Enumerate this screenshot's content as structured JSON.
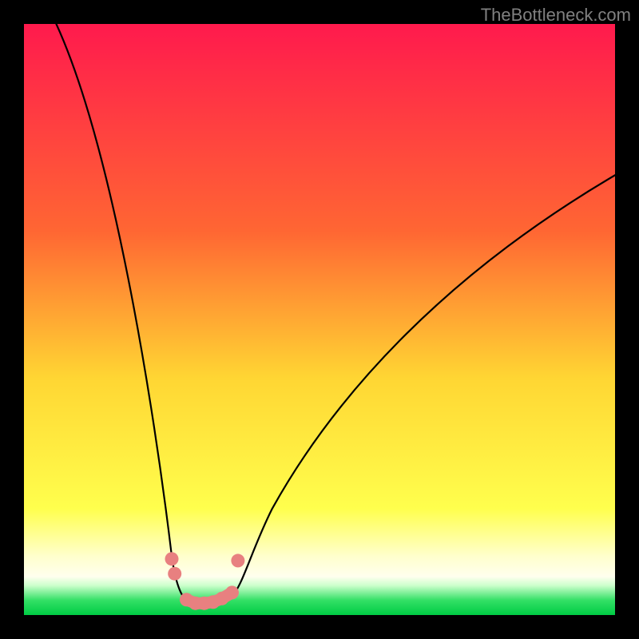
{
  "watermark": "TheBottleneck.com",
  "chart_data": {
    "type": "line",
    "title": "",
    "xlabel": "",
    "ylabel": "",
    "xlim": [
      0,
      100
    ],
    "ylim": [
      0,
      100
    ],
    "background_gradient": {
      "type": "custom",
      "description": "Red (top) to yellow (middle) to pale-yellow then very thin green band at bottom",
      "stops": [
        {
          "pos": 0.0,
          "color": "#ff1a4d"
        },
        {
          "pos": 0.35,
          "color": "#ff6633"
        },
        {
          "pos": 0.6,
          "color": "#ffd633"
        },
        {
          "pos": 0.82,
          "color": "#ffff4d"
        },
        {
          "pos": 0.9,
          "color": "#ffffcc"
        },
        {
          "pos": 0.935,
          "color": "#ffffee"
        },
        {
          "pos": 0.95,
          "color": "#ccffcc"
        },
        {
          "pos": 0.975,
          "color": "#33e066"
        },
        {
          "pos": 1.0,
          "color": "#00cc44"
        }
      ]
    },
    "curve": {
      "type": "v-shape",
      "notch_x": 29,
      "left_branch": [
        {
          "x": 5,
          "y": 99
        },
        {
          "x": 10,
          "y": 85
        },
        {
          "x": 15,
          "y": 65
        },
        {
          "x": 20,
          "y": 40
        },
        {
          "x": 24,
          "y": 15
        },
        {
          "x": 27,
          "y": 3
        }
      ],
      "bottom": [
        {
          "x": 27,
          "y": 3
        },
        {
          "x": 29,
          "y": 1
        },
        {
          "x": 31,
          "y": 1
        },
        {
          "x": 33,
          "y": 2
        },
        {
          "x": 35,
          "y": 3
        }
      ],
      "right_branch": [
        {
          "x": 35,
          "y": 3
        },
        {
          "x": 40,
          "y": 12
        },
        {
          "x": 50,
          "y": 30
        },
        {
          "x": 60,
          "y": 44
        },
        {
          "x": 70,
          "y": 55
        },
        {
          "x": 80,
          "y": 64
        },
        {
          "x": 90,
          "y": 70
        },
        {
          "x": 100,
          "y": 75
        }
      ]
    },
    "marker_points": [
      {
        "x": 25.0,
        "y": 9.5
      },
      {
        "x": 25.5,
        "y": 7.0
      },
      {
        "x": 27.5,
        "y": 2.6
      },
      {
        "x": 29.0,
        "y": 2.0
      },
      {
        "x": 30.5,
        "y": 2.0
      },
      {
        "x": 32.0,
        "y": 2.2
      },
      {
        "x": 33.5,
        "y": 2.8
      },
      {
        "x": 35.2,
        "y": 3.8
      },
      {
        "x": 36.2,
        "y": 9.2
      }
    ],
    "marker_color": "#e88080",
    "curve_color": "#000000"
  }
}
